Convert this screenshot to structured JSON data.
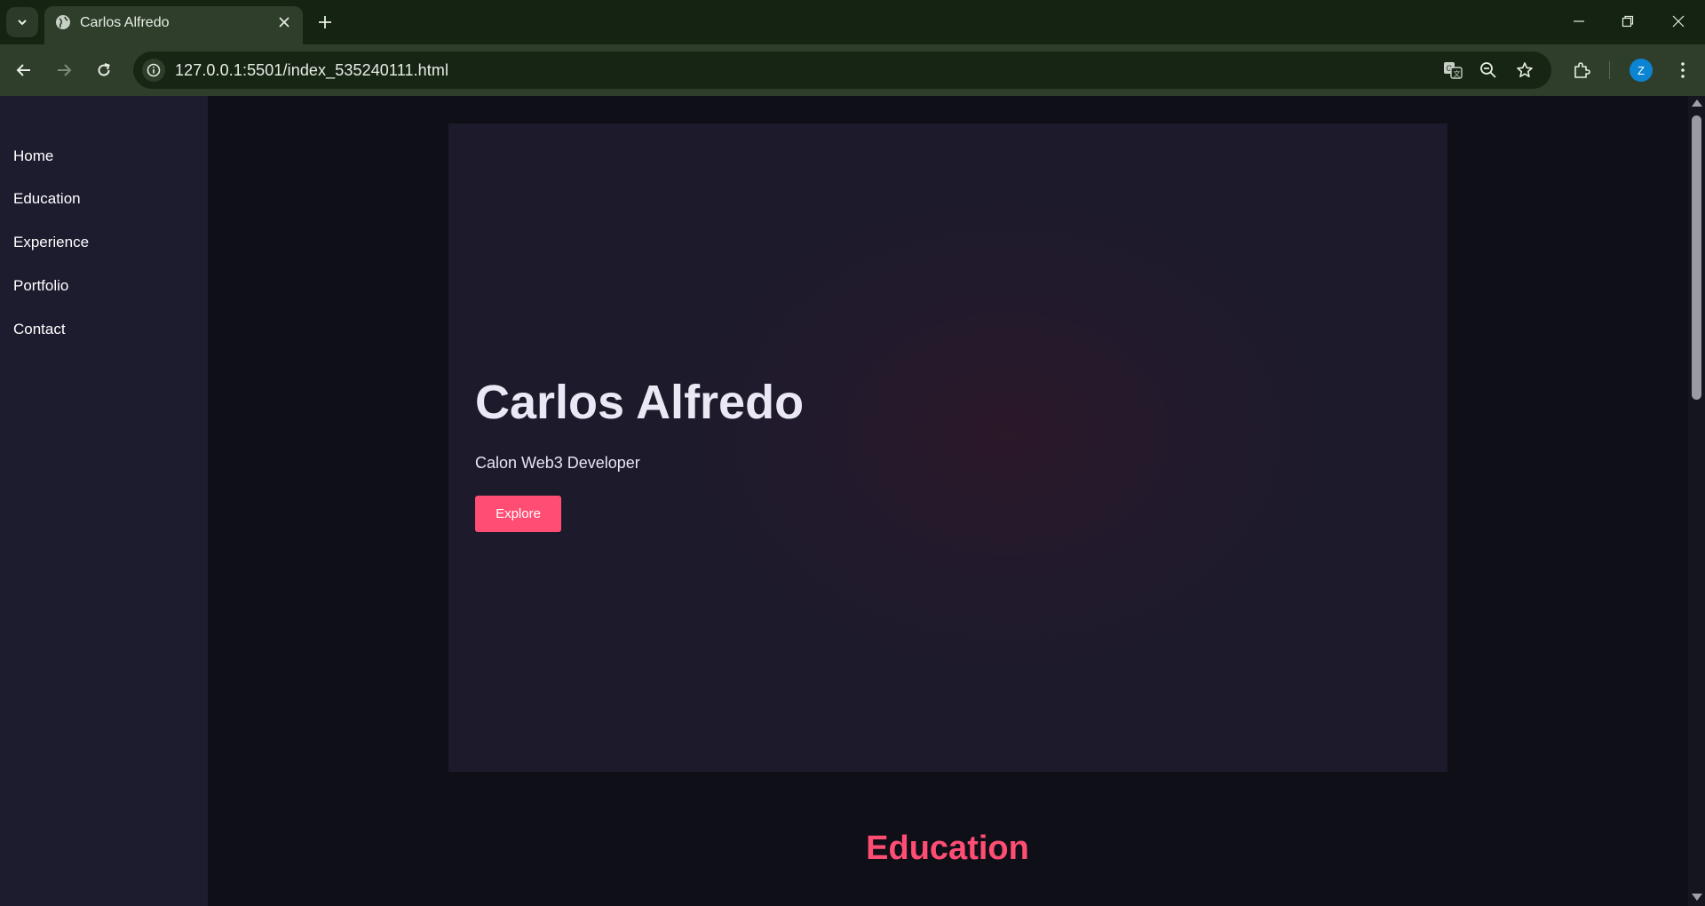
{
  "browser": {
    "tab_title": "Carlos Alfredo",
    "url": "127.0.0.1:5501/index_535240111.html",
    "profile_initial": "Z"
  },
  "sidebar": {
    "items": [
      {
        "label": "Home"
      },
      {
        "label": "Education"
      },
      {
        "label": "Experience"
      },
      {
        "label": "Portfolio"
      },
      {
        "label": "Contact"
      }
    ]
  },
  "hero": {
    "title": "Carlos Alfredo",
    "subtitle": "Calon Web3 Developer",
    "button_label": "Explore"
  },
  "sections": {
    "education_title": "Education"
  },
  "colors": {
    "accent": "#ff4d73",
    "sidebar_bg": "#1d1b2e",
    "page_bg": "#0f0f17",
    "chrome_bg": "#2f3e2b"
  }
}
